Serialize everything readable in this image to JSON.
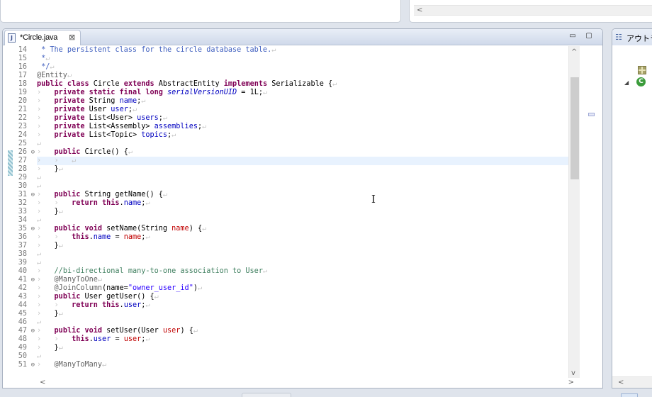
{
  "editor": {
    "tab_label": "*Circle.java",
    "tab_icon": "java-file-icon",
    "close_glyph": "⊠",
    "minimize_glyph": "▭",
    "maximize_glyph": "▢"
  },
  "outline": {
    "title": "アウトラ",
    "package_icon": "package-icon",
    "class_icon_letter": "C",
    "collapse_glyph": "◢"
  },
  "scroll_glyphs": {
    "left": "<",
    "right": ">",
    "up": "^",
    "down": "v"
  },
  "colors": {
    "keyword": "#7f0055",
    "javadoc": "#3f5fbf",
    "comment": "#3f7f5f",
    "annotation": "#646464",
    "field": "#0000c0",
    "string": "#2a00ff",
    "parameter": "#c00000",
    "current_line": "#e8f2fe"
  },
  "code": {
    "current_line": 27,
    "lines": [
      {
        "n": "14",
        "fold": false,
        "tokens": [
          {
            "t": "cm",
            "v": " * The persistent class for the circle database table."
          },
          {
            "t": "ws",
            "v": "↵"
          }
        ]
      },
      {
        "n": "15",
        "fold": false,
        "tokens": [
          {
            "t": "cm",
            "v": " *"
          },
          {
            "t": "ws",
            "v": "↵"
          }
        ]
      },
      {
        "n": "16",
        "fold": false,
        "tokens": [
          {
            "t": "cm",
            "v": " */"
          },
          {
            "t": "ws",
            "v": "↵"
          }
        ]
      },
      {
        "n": "17",
        "fold": false,
        "tokens": [
          {
            "t": "an",
            "v": "@Entity"
          },
          {
            "t": "ws",
            "v": "↵"
          }
        ]
      },
      {
        "n": "18",
        "fold": false,
        "tokens": [
          {
            "t": "kw",
            "v": "public class"
          },
          {
            "t": "",
            "v": " Circle "
          },
          {
            "t": "kw",
            "v": "extends"
          },
          {
            "t": "",
            "v": " AbstractEntity "
          },
          {
            "t": "kw",
            "v": "implements"
          },
          {
            "t": "",
            "v": " Serializable {"
          },
          {
            "t": "ws",
            "v": "↵"
          }
        ]
      },
      {
        "n": "19",
        "fold": false,
        "tokens": [
          {
            "t": "ws",
            "v": "›   "
          },
          {
            "t": "kw",
            "v": "private static final long"
          },
          {
            "t": "",
            "v": " "
          },
          {
            "t": "fi",
            "v": "serialVersionUID"
          },
          {
            "t": "",
            "v": " = 1L;"
          },
          {
            "t": "ws",
            "v": "↵"
          }
        ]
      },
      {
        "n": "20",
        "fold": false,
        "tokens": [
          {
            "t": "ws",
            "v": "›   "
          },
          {
            "t": "kw",
            "v": "private"
          },
          {
            "t": "",
            "v": " String "
          },
          {
            "t": "fd",
            "v": "name"
          },
          {
            "t": "",
            "v": ";"
          },
          {
            "t": "ws",
            "v": "↵"
          }
        ]
      },
      {
        "n": "21",
        "fold": false,
        "tokens": [
          {
            "t": "ws",
            "v": "›   "
          },
          {
            "t": "kw",
            "v": "private"
          },
          {
            "t": "",
            "v": " User "
          },
          {
            "t": "fd",
            "v": "user"
          },
          {
            "t": "",
            "v": ";"
          },
          {
            "t": "ws",
            "v": "↵"
          }
        ]
      },
      {
        "n": "22",
        "fold": false,
        "tokens": [
          {
            "t": "ws",
            "v": "›   "
          },
          {
            "t": "kw",
            "v": "private"
          },
          {
            "t": "",
            "v": " List<User> "
          },
          {
            "t": "fd",
            "v": "users"
          },
          {
            "t": "",
            "v": ";"
          },
          {
            "t": "ws",
            "v": "↵"
          }
        ]
      },
      {
        "n": "23",
        "fold": false,
        "tokens": [
          {
            "t": "ws",
            "v": "›   "
          },
          {
            "t": "kw",
            "v": "private"
          },
          {
            "t": "",
            "v": " List<Assembly> "
          },
          {
            "t": "fd",
            "v": "assemblies"
          },
          {
            "t": "",
            "v": ";"
          },
          {
            "t": "ws",
            "v": "↵"
          }
        ]
      },
      {
        "n": "24",
        "fold": false,
        "tokens": [
          {
            "t": "ws",
            "v": "›   "
          },
          {
            "t": "kw",
            "v": "private"
          },
          {
            "t": "",
            "v": " List<Topic> "
          },
          {
            "t": "fd",
            "v": "topics"
          },
          {
            "t": "",
            "v": ";"
          },
          {
            "t": "ws",
            "v": "↵"
          }
        ]
      },
      {
        "n": "25",
        "fold": false,
        "tokens": [
          {
            "t": "ws",
            "v": "↵"
          }
        ]
      },
      {
        "n": "26",
        "fold": true,
        "tokens": [
          {
            "t": "ws",
            "v": "›   "
          },
          {
            "t": "kw",
            "v": "public"
          },
          {
            "t": "",
            "v": " Circle() {"
          },
          {
            "t": "ws",
            "v": "↵"
          }
        ]
      },
      {
        "n": "27",
        "fold": false,
        "tokens": [
          {
            "t": "ws",
            "v": "›   ›   ↵"
          }
        ]
      },
      {
        "n": "28",
        "fold": false,
        "tokens": [
          {
            "t": "ws",
            "v": "›   "
          },
          {
            "t": "",
            "v": "}"
          },
          {
            "t": "ws",
            "v": "↵"
          }
        ]
      },
      {
        "n": "29",
        "fold": false,
        "tokens": [
          {
            "t": "ws",
            "v": "↵"
          }
        ]
      },
      {
        "n": "30",
        "fold": false,
        "tokens": [
          {
            "t": "ws",
            "v": "↵"
          }
        ]
      },
      {
        "n": "31",
        "fold": true,
        "tokens": [
          {
            "t": "ws",
            "v": "›   "
          },
          {
            "t": "kw",
            "v": "public"
          },
          {
            "t": "",
            "v": " String getName() {"
          },
          {
            "t": "ws",
            "v": "↵"
          }
        ]
      },
      {
        "n": "32",
        "fold": false,
        "tokens": [
          {
            "t": "ws",
            "v": "›   ›   "
          },
          {
            "t": "kw",
            "v": "return this"
          },
          {
            "t": "",
            "v": "."
          },
          {
            "t": "fd",
            "v": "name"
          },
          {
            "t": "",
            "v": ";"
          },
          {
            "t": "ws",
            "v": "↵"
          }
        ]
      },
      {
        "n": "33",
        "fold": false,
        "tokens": [
          {
            "t": "ws",
            "v": "›   "
          },
          {
            "t": "",
            "v": "}"
          },
          {
            "t": "ws",
            "v": "↵"
          }
        ]
      },
      {
        "n": "34",
        "fold": false,
        "tokens": [
          {
            "t": "ws",
            "v": "↵"
          }
        ]
      },
      {
        "n": "35",
        "fold": true,
        "tokens": [
          {
            "t": "ws",
            "v": "›   "
          },
          {
            "t": "kw",
            "v": "public void"
          },
          {
            "t": "",
            "v": " setName(String "
          },
          {
            "t": "pm",
            "v": "name"
          },
          {
            "t": "",
            "v": ") {"
          },
          {
            "t": "ws",
            "v": "↵"
          }
        ]
      },
      {
        "n": "36",
        "fold": false,
        "tokens": [
          {
            "t": "ws",
            "v": "›   ›   "
          },
          {
            "t": "kw",
            "v": "this"
          },
          {
            "t": "",
            "v": "."
          },
          {
            "t": "fd",
            "v": "name"
          },
          {
            "t": "",
            "v": " = "
          },
          {
            "t": "pm",
            "v": "name"
          },
          {
            "t": "",
            "v": ";"
          },
          {
            "t": "ws",
            "v": "↵"
          }
        ]
      },
      {
        "n": "37",
        "fold": false,
        "tokens": [
          {
            "t": "ws",
            "v": "›   "
          },
          {
            "t": "",
            "v": "}"
          },
          {
            "t": "ws",
            "v": "↵"
          }
        ]
      },
      {
        "n": "38",
        "fold": false,
        "tokens": [
          {
            "t": "ws",
            "v": "↵"
          }
        ]
      },
      {
        "n": "39",
        "fold": false,
        "tokens": [
          {
            "t": "ws",
            "v": "↵"
          }
        ]
      },
      {
        "n": "40",
        "fold": false,
        "tokens": [
          {
            "t": "ws",
            "v": "›   "
          },
          {
            "t": "lc",
            "v": "//bi-directional many-to-one association to User"
          },
          {
            "t": "ws",
            "v": "↵"
          }
        ]
      },
      {
        "n": "41",
        "fold": true,
        "tokens": [
          {
            "t": "ws",
            "v": "›   "
          },
          {
            "t": "an",
            "v": "@ManyToOne"
          },
          {
            "t": "ws",
            "v": "↵"
          }
        ]
      },
      {
        "n": "42",
        "fold": false,
        "tokens": [
          {
            "t": "ws",
            "v": "›   "
          },
          {
            "t": "an",
            "v": "@JoinColumn"
          },
          {
            "t": "",
            "v": "(name="
          },
          {
            "t": "st",
            "v": "\"owner_user_id\""
          },
          {
            "t": "",
            "v": ")"
          },
          {
            "t": "ws",
            "v": "↵"
          }
        ]
      },
      {
        "n": "43",
        "fold": false,
        "tokens": [
          {
            "t": "ws",
            "v": "›   "
          },
          {
            "t": "kw",
            "v": "public"
          },
          {
            "t": "",
            "v": " User getUser() {"
          },
          {
            "t": "ws",
            "v": "↵"
          }
        ]
      },
      {
        "n": "44",
        "fold": false,
        "tokens": [
          {
            "t": "ws",
            "v": "›   ›   "
          },
          {
            "t": "kw",
            "v": "return this"
          },
          {
            "t": "",
            "v": "."
          },
          {
            "t": "fd",
            "v": "user"
          },
          {
            "t": "",
            "v": ";"
          },
          {
            "t": "ws",
            "v": "↵"
          }
        ]
      },
      {
        "n": "45",
        "fold": false,
        "tokens": [
          {
            "t": "ws",
            "v": "›   "
          },
          {
            "t": "",
            "v": "}"
          },
          {
            "t": "ws",
            "v": "↵"
          }
        ]
      },
      {
        "n": "46",
        "fold": false,
        "tokens": [
          {
            "t": "ws",
            "v": "↵"
          }
        ]
      },
      {
        "n": "47",
        "fold": true,
        "tokens": [
          {
            "t": "ws",
            "v": "›   "
          },
          {
            "t": "kw",
            "v": "public void"
          },
          {
            "t": "",
            "v": " setUser(User "
          },
          {
            "t": "pm",
            "v": "user"
          },
          {
            "t": "",
            "v": ") {"
          },
          {
            "t": "ws",
            "v": "↵"
          }
        ]
      },
      {
        "n": "48",
        "fold": false,
        "tokens": [
          {
            "t": "ws",
            "v": "›   ›   "
          },
          {
            "t": "kw",
            "v": "this"
          },
          {
            "t": "",
            "v": "."
          },
          {
            "t": "fd",
            "v": "user"
          },
          {
            "t": "",
            "v": " = "
          },
          {
            "t": "pm",
            "v": "user"
          },
          {
            "t": "",
            "v": ";"
          },
          {
            "t": "ws",
            "v": "↵"
          }
        ]
      },
      {
        "n": "49",
        "fold": false,
        "tokens": [
          {
            "t": "ws",
            "v": "›   "
          },
          {
            "t": "",
            "v": "}"
          },
          {
            "t": "ws",
            "v": "↵"
          }
        ]
      },
      {
        "n": "50",
        "fold": false,
        "tokens": [
          {
            "t": "ws",
            "v": "↵"
          }
        ]
      },
      {
        "n": "51",
        "fold": true,
        "tokens": [
          {
            "t": "ws",
            "v": "›   "
          },
          {
            "t": "an",
            "v": "@ManyToMany"
          },
          {
            "t": "ws",
            "v": "↵"
          }
        ]
      }
    ]
  }
}
